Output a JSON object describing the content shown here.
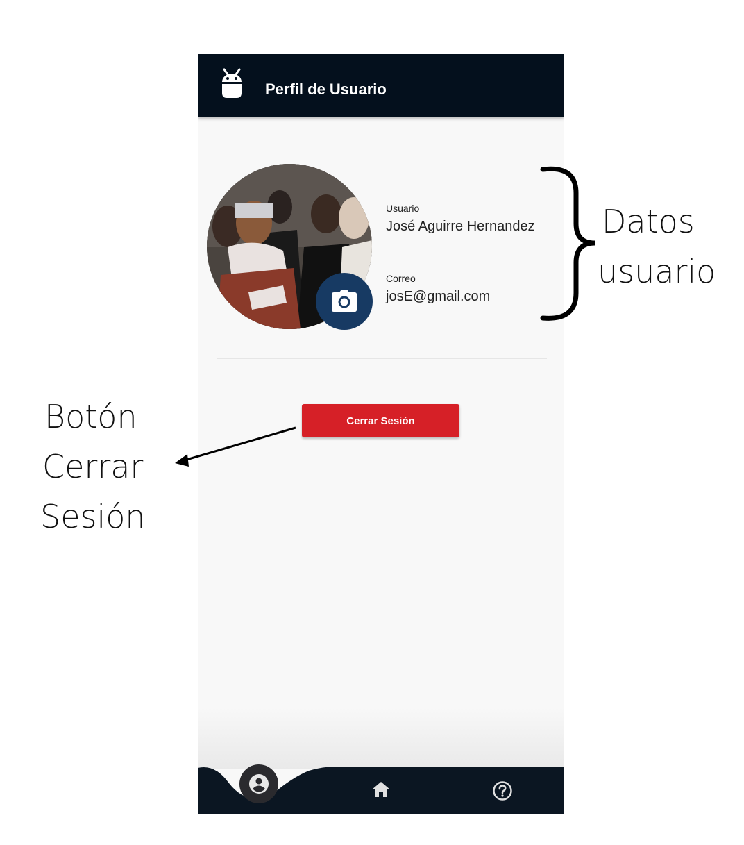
{
  "appbar": {
    "title": "Perfil de Usuario",
    "logo_icon": "android-icon"
  },
  "profile": {
    "avatar_alt": "profile-photo",
    "camera_icon": "camera-icon",
    "username_label": "Usuario",
    "username_value": "José Aguirre Hernandez",
    "email_label": "Correo",
    "email_value": "josE@gmail.com"
  },
  "actions": {
    "logout_label": "Cerrar Sesión"
  },
  "bottom_nav": {
    "items": [
      {
        "icon": "account-circle-icon",
        "active": true
      },
      {
        "icon": "home-icon",
        "active": false
      },
      {
        "icon": "help-circle-icon",
        "active": false
      }
    ]
  },
  "annotations": {
    "user_data_line1": "Datos",
    "user_data_line2": "usuario",
    "logout_line1": "Botón",
    "logout_line2": "Cerrar",
    "logout_line3": "Sesión"
  },
  "colors": {
    "appbar": "#04101d",
    "camera_button": "#173a63",
    "logout_button": "#d62027",
    "nav_bar": "#0b1622"
  }
}
